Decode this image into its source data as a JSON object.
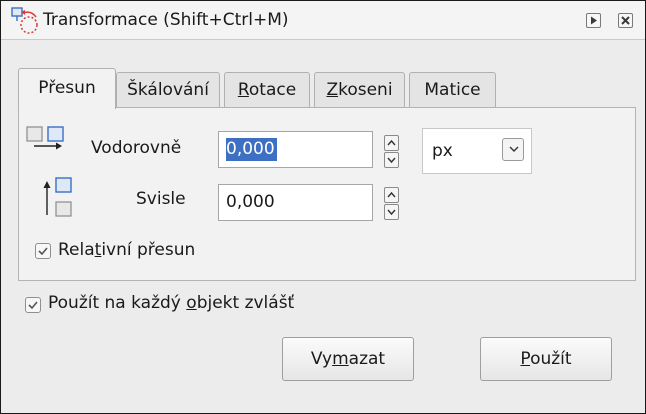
{
  "window": {
    "title": "Transformace (Shift+Ctrl+M)",
    "icons": [
      "transform-icon",
      "play-icon",
      "close-icon"
    ]
  },
  "tabs": [
    {
      "label": "Přesun",
      "active": true
    },
    {
      "label_pre": "Škálování",
      "label_u": "",
      "label_post": ""
    },
    {
      "label_pre": "",
      "label_u": "R",
      "label_post": "otace"
    },
    {
      "label_pre": "",
      "label_u": "Z",
      "label_post": "koseni"
    },
    {
      "label_pre": "Matice",
      "label_u": "",
      "label_post": ""
    }
  ],
  "move": {
    "horizontal_label": "Vodorovně",
    "horizontal_value": "0,000",
    "vertical_label": "Svisle",
    "vertical_value": "0,000",
    "unit": "px",
    "relative": {
      "pre": "Rela",
      "u": "t",
      "post": "ivní přesun",
      "checked": true
    }
  },
  "apply_each": {
    "pre": "Použít na každý ",
    "u": "o",
    "post": "bjekt zvlášť",
    "checked": true
  },
  "buttons": {
    "clear": {
      "pre": "Vy",
      "u": "m",
      "post": "azat"
    },
    "apply": {
      "pre": "",
      "u": "P",
      "post": "oužít"
    }
  },
  "colors": {
    "selection": "#3d6fc2",
    "icon_blue": "#3a6fc4",
    "icon_red": "#d83a3a"
  }
}
